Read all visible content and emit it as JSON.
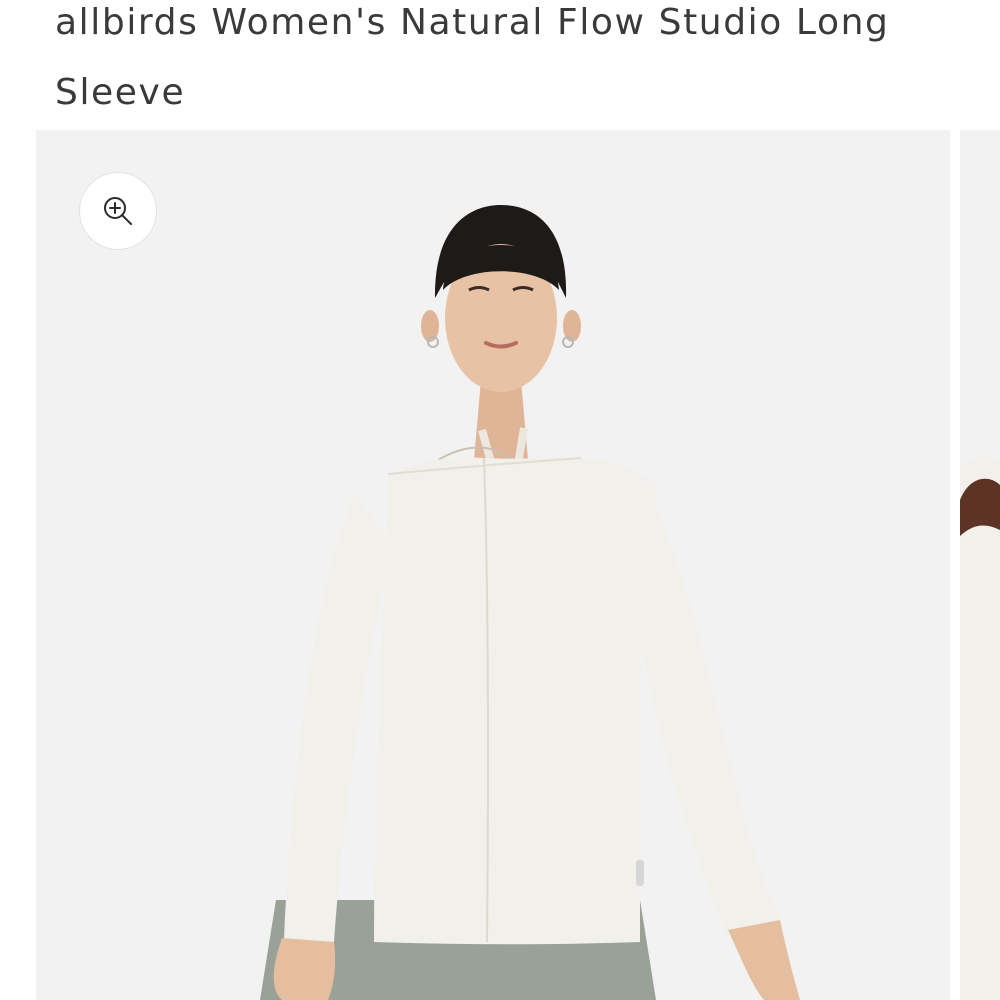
{
  "product": {
    "title": "allbirds Women's Natural Flow Studio Long Sleeve"
  },
  "gallery": {
    "zoom_icon": "zoom-in-icon",
    "main_image": "model wearing natural white long sleeve top with grey leggings",
    "next_image": "partial view of next product photo"
  },
  "colors": {
    "background": "#ffffff",
    "image_background": "#f2f2f2",
    "title_text": "#3a3a3a",
    "shirt": "#f1f0ea",
    "leggings": "#9aa196",
    "hair": "#1e1a18"
  }
}
